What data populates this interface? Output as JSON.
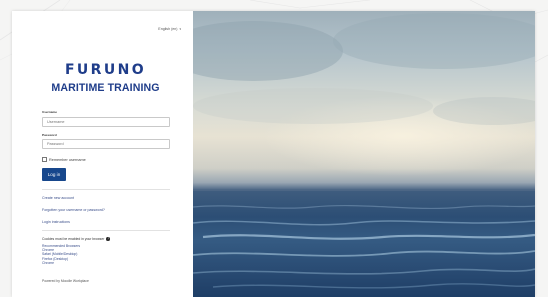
{
  "header": {
    "language_label": "English (en)"
  },
  "brand": {
    "name": "FURUNO",
    "subtitle": "MARITIME TRAINING"
  },
  "login_form": {
    "username_label": "Username",
    "username_placeholder": "Username",
    "password_label": "Password",
    "password_placeholder": "Password",
    "remember_label": "Remember username",
    "login_button": "Log in"
  },
  "links": {
    "create_account": "Create new account",
    "forgot_password": "Forgotten your username or password?",
    "login_instructions": "Login instructions"
  },
  "browser_note": {
    "text": "Cookies must be enabled in your browser",
    "browsers": [
      "Recommended Browsers",
      "Chrome",
      "Safari (Mobile/Desktop)",
      "Firefox (Desktop)",
      "Chrome"
    ]
  },
  "footer": {
    "powered_by": "Powered by Moodle Workplace"
  },
  "icons": {
    "info": "info-icon",
    "language_caret": "chevron-down-icon"
  },
  "colors": {
    "brand_blue": "#1f3d8a",
    "button_blue": "#17478c"
  }
}
